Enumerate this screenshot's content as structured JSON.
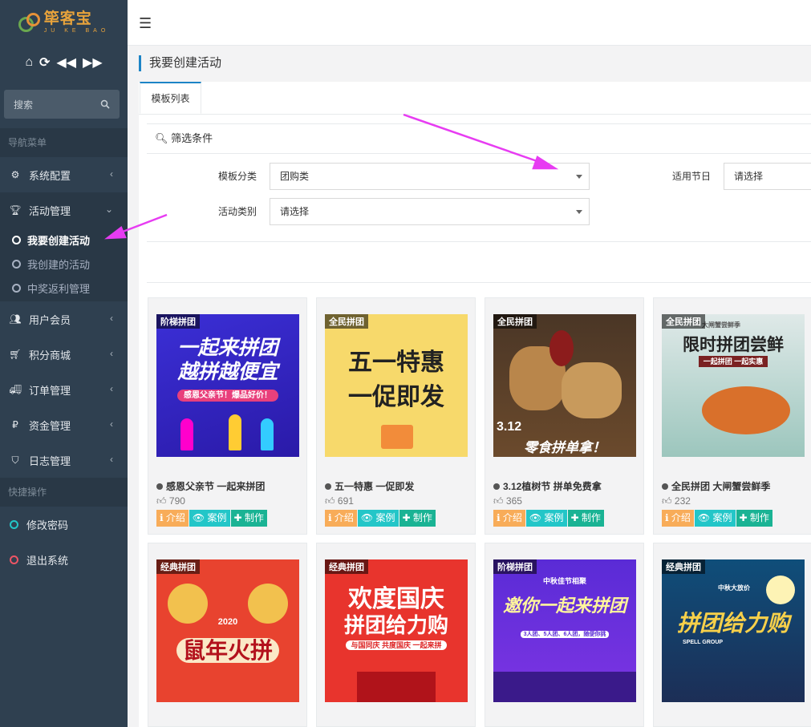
{
  "sidebar": {
    "logo_title": "筚客宝",
    "logo_sub": "JU KE BAO",
    "search_placeholder": "搜索",
    "nav_section": "导航菜单",
    "menu": [
      {
        "label": "系统配置",
        "icon": "gear-icon"
      },
      {
        "label": "活动管理",
        "icon": "trophy-icon"
      },
      {
        "label": "用户会员",
        "icon": "users-icon"
      },
      {
        "label": "积分商城",
        "icon": "cart-icon"
      },
      {
        "label": "订单管理",
        "icon": "truck-icon"
      },
      {
        "label": "资金管理",
        "icon": "ruble-icon"
      },
      {
        "label": "日志管理",
        "icon": "shield-icon"
      }
    ],
    "submenu": [
      "我要创建活动",
      "我创建的活动",
      "中奖返利管理"
    ],
    "quick_section": "快捷操作",
    "quick": [
      "修改密码",
      "退出系统"
    ]
  },
  "page": {
    "title": "我要创建活动",
    "tab": "模板列表",
    "filter_title": "筛选条件",
    "filters": {
      "template_category_label": "模板分类",
      "template_category_value": "团购类",
      "holiday_label": "适用节日",
      "holiday_value": "请选择",
      "activity_type_label": "活动类别",
      "activity_type_value": "请选择"
    }
  },
  "buttons": {
    "intro": "介绍",
    "case": "案例",
    "make": "制作"
  },
  "cards": [
    {
      "badge": "阶梯拼团",
      "title": "感恩父亲节 一起来拼团",
      "likes": "790",
      "poster": [
        "一起来拼团",
        "越拼越便宜",
        "感恩父亲节！爆品好价！"
      ]
    },
    {
      "badge": "全民拼团",
      "title": "五一特惠 一促即发",
      "likes": "691",
      "poster": [
        "五一特惠",
        "一促即发"
      ]
    },
    {
      "badge": "全民拼团",
      "title": "3.12植树节 拼单免费拿",
      "likes": "365",
      "poster": [
        "3.12",
        "零食拼单拿！"
      ]
    },
    {
      "badge": "全民拼团",
      "title": "全民拼团 大闸蟹尝鲜季",
      "likes": "232",
      "poster": [
        "大闸蟹尝鲜季",
        "限时拼团尝鲜",
        "一起拼团 一起实惠"
      ]
    },
    {
      "badge": "经典拼团",
      "title": "",
      "likes": "",
      "poster": [
        "2020",
        "鼠年火拼"
      ]
    },
    {
      "badge": "经典拼团",
      "title": "",
      "likes": "",
      "poster": [
        "欢度国庆",
        "拼团给力购",
        "与国同庆 共度国庆 一起来拼"
      ]
    },
    {
      "badge": "阶梯拼团",
      "title": "",
      "likes": "",
      "poster": [
        "中秋佳节相聚",
        "邀你一起来拼团",
        "3人团、5人团、6人团，随便你挑"
      ]
    },
    {
      "badge": "经典拼团",
      "title": "",
      "likes": "",
      "poster": [
        "中秋大放价",
        "拼团给力购",
        "SPELL GROUP"
      ]
    }
  ],
  "colors": {
    "sidebar_bg": "#2f4050",
    "accent_teal": "#1ab394",
    "arrow_magenta": "#e73cf2",
    "btn_intro": "#f8ac59",
    "btn_case": "#23c6c8"
  }
}
